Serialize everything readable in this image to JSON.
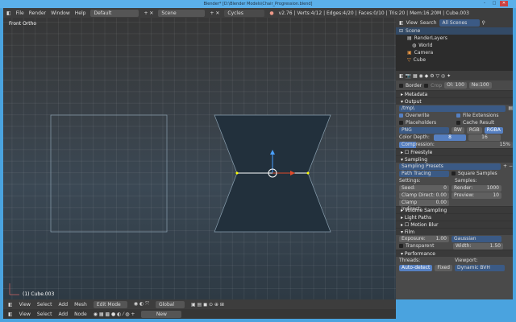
{
  "window": {
    "title": "Blender* [D:\\Blender Models\\Chair_Progression.blend]",
    "min": "–",
    "max": "□",
    "close": "✕"
  },
  "topbar": {
    "menus": [
      "File",
      "Render",
      "Window",
      "Help"
    ],
    "layout": "Default",
    "scene": "Scene",
    "engine": "Cycles Render",
    "stats": "v2.76 | Verts:4/12 | Edges:4/20 | Faces:0/10 | Tris:20 | Mem:16.20M | Cube.003"
  },
  "viewport": {
    "view_label": "Front Ortho",
    "object_label": "(1) Cube.003"
  },
  "outliner": {
    "view": "View",
    "search": "Search",
    "filter": "All Scenes",
    "items": [
      "Scene",
      "RenderLayers",
      "World",
      "Camera",
      "Cube"
    ]
  },
  "properties": {
    "border": "Border",
    "crop": "Crop",
    "ol": "Ol: 100",
    "ne": "Ne:100",
    "metadata": "Metadata",
    "output": "Output",
    "path": "/tmp\\",
    "overwrite": "Overwrite",
    "file_extensions": "File Extensions",
    "placeholders": "Placeholders",
    "cache_result": "Cache Result",
    "format": "PNG",
    "bw": "BW",
    "rgb": "RGB",
    "rgba": "RGBA",
    "color_depth": "Color Depth:",
    "depth8": "8",
    "depth16": "16",
    "compression": "Compression:",
    "compression_value": "15%",
    "freestyle": "Freestyle",
    "sampling": "Sampling",
    "sampling_presets": "Sampling Presets",
    "path_tracing": "Path Tracing",
    "square_samples": "Square Samples",
    "settings": "Settings:",
    "samples": "Samples:",
    "seed": "Seed:",
    "seed_v": "0",
    "render": "Render:",
    "render_v": "1000",
    "clamp_direct": "Clamp Direct:",
    "clamp_direct_v": "0.00",
    "preview": "Preview:",
    "preview_v": "10",
    "clamp_indirect": "Clamp Indirect:",
    "clamp_indirect_v": "0.00",
    "volume_sampling": "Volume Sampling",
    "light_paths": "Light Paths",
    "motion_blur": "Motion Blur",
    "film": "Film",
    "exposure": "Exposure:",
    "exposure_v": "1.00",
    "filter": "Gaussian",
    "transparent": "Transparent",
    "width": "Width:",
    "width_v": "1.50",
    "performance": "Performance",
    "threads": "Threads:",
    "auto_detect": "Auto-detect",
    "fixed": "Fixed",
    "viewport": "Viewport:",
    "bvh": "Dynamic BVH"
  },
  "bottom1": {
    "items": [
      "View",
      "Select",
      "Add",
      "Mesh"
    ],
    "mode": "Edit Mode",
    "orientation": "Global"
  },
  "bottom2": {
    "items": [
      "View",
      "Select",
      "Add",
      "Node"
    ],
    "new": "New"
  }
}
